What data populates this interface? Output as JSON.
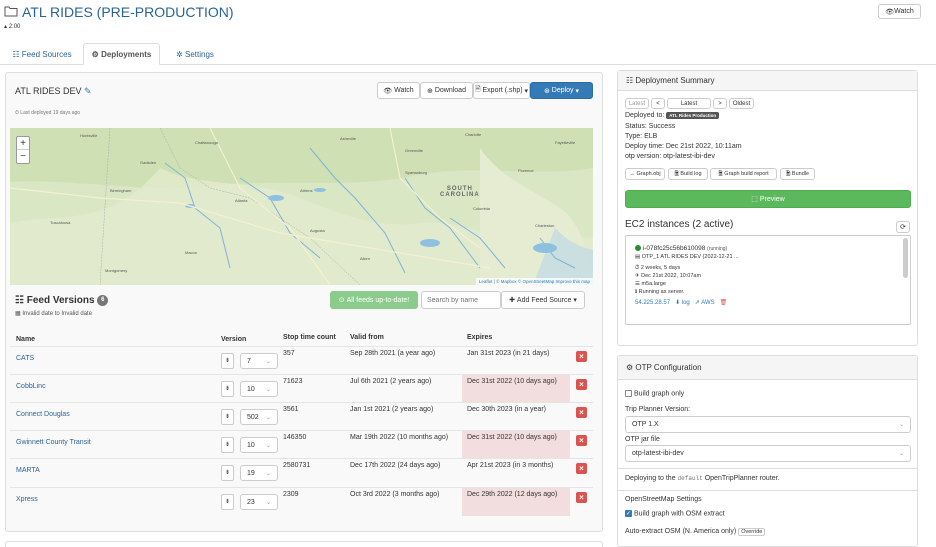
{
  "header": {
    "title": "ATL RIDES (PRE-PRODUCTION)",
    "subline": "2:00",
    "watch": "Watch"
  },
  "tabs": [
    {
      "label": "Feed Sources"
    },
    {
      "label": "Deployments"
    },
    {
      "label": "Settings"
    }
  ],
  "deployment": {
    "name": "ATL RIDES DEV",
    "last_deployed": "Last deployed 19 days ago",
    "buttons": {
      "watch": "Watch",
      "download": "Download",
      "export": "Export (.shp)",
      "deploy": "Deploy"
    }
  },
  "map": {
    "state_label": "SOUTH\nCAROLINA",
    "attribution": "Leaflet | © Mapbox © OpenStreetMap Improve this map",
    "zoom_in": "+",
    "zoom_out": "−"
  },
  "feed_versions": {
    "title": "Feed Versions",
    "count": "6",
    "subtitle": "Invalid date to Invalid date",
    "all_up_to_date": "All feeds up-to-date!",
    "search_placeholder": "Search by name",
    "add_feed": "Add Feed Source",
    "columns": [
      "Name",
      "Version",
      "Stop time count",
      "Valid from",
      "Expires"
    ],
    "rows": [
      {
        "name": "CATS",
        "version": "7",
        "stops": "357",
        "valid_from": "Sep 28th 2021 (a year ago)",
        "expires": "Jan 31st 2023 (in 21 days)",
        "expired": false
      },
      {
        "name": "CobbLinc",
        "version": "10",
        "stops": "71623",
        "valid_from": "Jul 6th 2021 (2 years ago)",
        "expires": "Dec 31st 2022 (10 days ago)",
        "expired": true
      },
      {
        "name": "Connect Douglas",
        "version": "502",
        "stops": "3561",
        "valid_from": "Jan 1st 2021 (2 years ago)",
        "expires": "Dec 30th 2023 (in a year)",
        "expired": false
      },
      {
        "name": "Gwinnett County Transit",
        "version": "10",
        "stops": "146350",
        "valid_from": "Mar 19th 2022 (10 months ago)",
        "expires": "Dec 31st 2022 (10 days ago)",
        "expired": true
      },
      {
        "name": "MARTA",
        "version": "19",
        "stops": "2580731",
        "valid_from": "Dec 17th 2022 (24 days ago)",
        "expires": "Apr 21st 2023 (in 3 months)",
        "expired": false
      },
      {
        "name": "Xpress",
        "version": "23",
        "stops": "2309",
        "valid_from": "Oct 3rd 2022 (3 months ago)",
        "expires": "Dec 29th 2022 (12 days ago)",
        "expired": true
      }
    ]
  },
  "summary": {
    "title": "Deployment Summary",
    "nav": {
      "latest": "Latest",
      "prev": "<",
      "current": "Latest",
      "next": ">",
      "oldest": "Oldest"
    },
    "deployed_to_label": "Deployed to:",
    "deployed_to_badge": "ATL Rides Production",
    "status": "Status: Success",
    "type": "Type: ELB",
    "deploy_time": "Deploy time: Dec 21st 2022, 10:11am",
    "otp_version": "otp version: otp-latest-ibi-dev",
    "files": [
      "Graph.obj",
      "Build log",
      "Graph build report",
      "Bundle"
    ],
    "preview": "Preview"
  },
  "ec2": {
    "title": "EC2 instances (2 active)",
    "instance": {
      "id": "i-078fc25c56b610098",
      "state": "(running)",
      "name": "OTP_1 ATL RIDES DEV (2022-12-21 ...",
      "uptime": "2 weeks, 5 days",
      "launched": "Dec 21st 2022, 10:07am",
      "type": "m5a.large",
      "status": "Running as server.",
      "ip": "54.225.28.57",
      "log": "log",
      "aws": "AWS"
    }
  },
  "otp": {
    "title": "OTP Configuration",
    "build_graph_only": "Build graph only",
    "trip_planner_label": "Trip Planner Version:",
    "trip_planner_value": "OTP 1.X",
    "jar_label": "OTP jar file",
    "jar_value": "otp-latest-ibi-dev",
    "deploying_to_prefix": "Deploying to the",
    "deploying_to_target": "default",
    "deploying_to_suffix": "OpenTripPlanner router.",
    "osm_settings": "OpenStreetMap Settings",
    "build_with_osm": "Build graph with OSM extract",
    "auto_extract": "Auto-extract OSM (N. America only)",
    "override": "Override"
  },
  "colors": {
    "primary": "#337ab7",
    "danger": "#d9534f",
    "success": "#5cb85c",
    "expired_bg": "#f2dede"
  }
}
